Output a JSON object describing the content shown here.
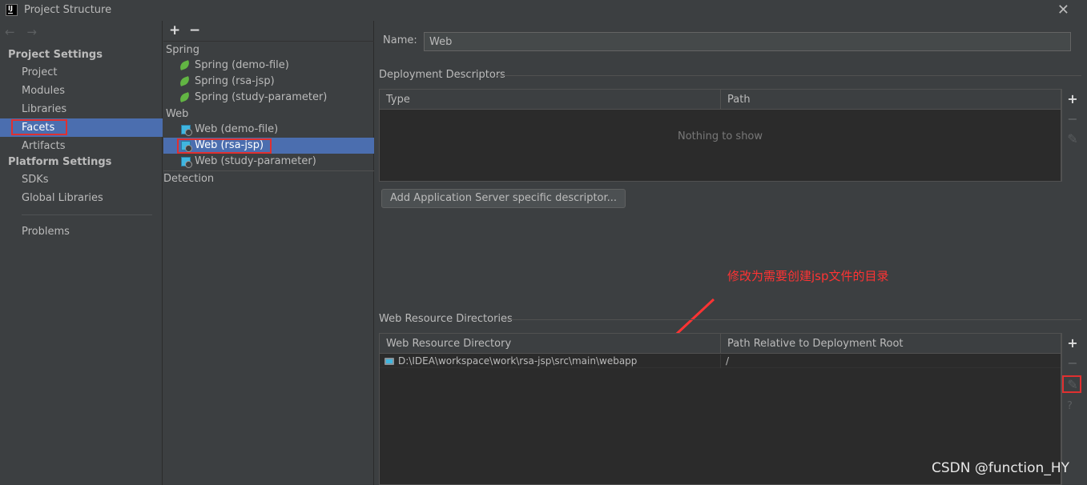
{
  "window": {
    "title": "Project Structure",
    "app_icon_text": "IJ"
  },
  "nav": {
    "back_arrow": "←",
    "forward_arrow": "→",
    "project_settings_header": "Project Settings",
    "project_items": [
      "Project",
      "Modules",
      "Libraries",
      "Facets",
      "Artifacts"
    ],
    "platform_settings_header": "Platform Settings",
    "platform_items": [
      "SDKs",
      "Global Libraries"
    ],
    "problems": "Problems",
    "selected": "Facets"
  },
  "facets": {
    "toolbar": {
      "add": "+",
      "remove": "−"
    },
    "spring_group": "Spring",
    "spring_items": [
      "Spring (demo-file)",
      "Spring (rsa-jsp)",
      "Spring (study-parameter)"
    ],
    "web_group": "Web",
    "web_items": [
      "Web (demo-file)",
      "Web (rsa-jsp)",
      "Web (study-parameter)"
    ],
    "selected": "Web (rsa-jsp)",
    "detection": "Detection"
  },
  "detail": {
    "name_label": "Name:",
    "name_value": "Web",
    "deployment_descriptors": {
      "title": "Deployment Descriptors",
      "columns": [
        "Type",
        "Path"
      ],
      "empty_text": "Nothing to show",
      "add_button": "Add Application Server specific descriptor..."
    },
    "web_resource_directories": {
      "title": "Web Resource Directories",
      "columns": [
        "Web Resource Directory",
        "Path Relative to Deployment Root"
      ],
      "rows": [
        {
          "directory": "D:\\IDEA\\workspace\\work\\rsa-jsp\\src\\main\\webapp",
          "relative_path": "/"
        }
      ]
    },
    "side_tools": {
      "add": "+",
      "remove": "−",
      "edit": "✎",
      "help": "?"
    }
  },
  "annotation": {
    "text": "修改为需要创建jsp文件的目录",
    "color": "#ff3333"
  },
  "watermark": "CSDN @function_HY",
  "colors": {
    "selection": "#4b6eaf",
    "highlight_box": "#e03030",
    "background": "#3c3f41"
  }
}
